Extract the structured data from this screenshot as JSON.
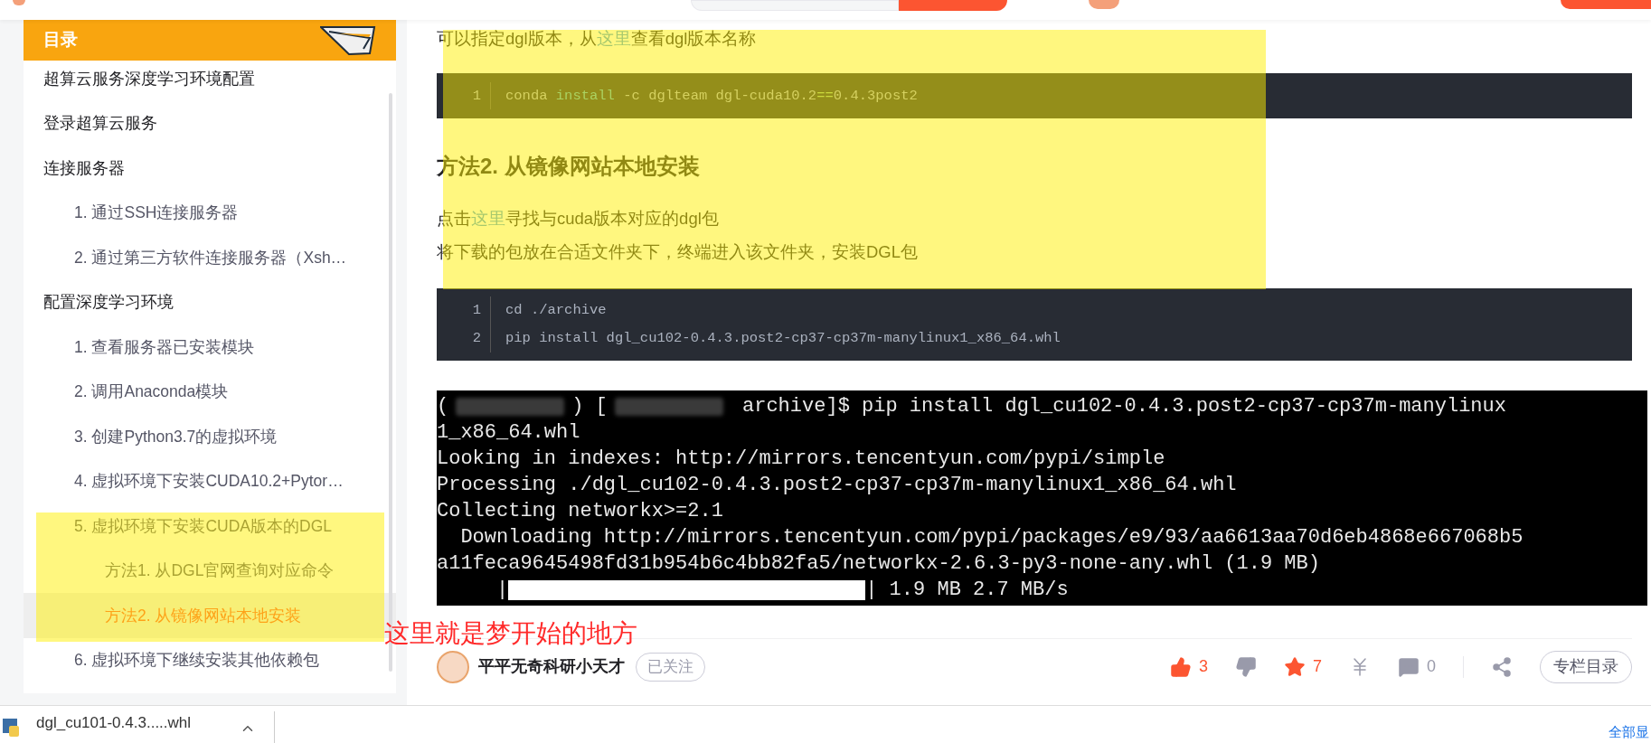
{
  "toc": {
    "title": "目录",
    "items": [
      {
        "label": "超算云服务深度学习环境配置",
        "selected": false
      },
      {
        "label": "登录超算云服务",
        "selected": false
      },
      {
        "label": "连接服务器",
        "selected": false,
        "children": [
          {
            "label": "1. 通过SSH连接服务器",
            "selected": false
          },
          {
            "label": "2. 通过第三方软件连接服务器（Xsh…",
            "selected": false
          }
        ]
      },
      {
        "label": "配置深度学习环境",
        "selected": false,
        "children": [
          {
            "label": "1. 查看服务器已安装模块",
            "selected": false
          },
          {
            "label": "2. 调用Anaconda模块",
            "selected": false
          },
          {
            "label": "3. 创建Python3.7的虚拟环境",
            "selected": false
          },
          {
            "label": "4. 虚拟环境下安装CUDA10.2+Pytor…",
            "selected": false
          },
          {
            "label": "5. 虚拟环境下安装CUDA版本的DGL",
            "selected": false,
            "children": [
              {
                "label": "方法1. 从DGL官网查询对应命令",
                "selected": false
              },
              {
                "label": "方法2. 从镜像网站本地安装",
                "selected": true
              }
            ]
          },
          {
            "label": "6. 虚拟环境下继续安装其他依赖包",
            "selected": false
          }
        ]
      }
    ]
  },
  "article": {
    "blocks": [
      {
        "kind": "paragraph",
        "lines": [
          [
            {
              "kind": "text",
              "text": "可以指定dgl版本，从"
            },
            {
              "kind": "link",
              "text": "这里"
            },
            {
              "kind": "text",
              "text": "查看dgl版本名称"
            }
          ]
        ]
      },
      {
        "kind": "code",
        "lines": [
          {
            "number": "1",
            "tokens": [
              {
                "text": "conda ",
                "kind": "plain"
              },
              {
                "text": "install",
                "kind": "keyword"
              },
              {
                "text": " -c dglteam dgl-cuda10.2",
                "kind": "plain"
              },
              {
                "text": "==",
                "kind": "operator"
              },
              {
                "text": "0.4.3post2",
                "kind": "plain"
              }
            ]
          }
        ]
      },
      {
        "kind": "heading",
        "text": "方法2. 从镜像网站本地安装"
      },
      {
        "kind": "paragraph",
        "lines": [
          [
            {
              "kind": "text",
              "text": "点击"
            },
            {
              "kind": "link",
              "text": "这里"
            },
            {
              "kind": "text",
              "text": "寻找与cuda版本对应的dgl包"
            }
          ],
          [
            {
              "kind": "text",
              "text": "将下载的包放在合适文件夹下，终端进入该文件夹，安装DGL包"
            }
          ]
        ]
      },
      {
        "kind": "code",
        "lines": [
          {
            "number": "1",
            "tokens": [
              {
                "text": "cd ./archive",
                "kind": "plain"
              }
            ]
          },
          {
            "number": "2",
            "tokens": [
              {
                "text": "pip install dgl_cu102-0.4.3.post2-cp37-cp37m-manylinux1_x86_64.whl",
                "kind": "plain"
              }
            ]
          }
        ]
      },
      {
        "kind": "terminal",
        "lines": [
          [
            {
              "kind": "text",
              "text": "("
            },
            {
              "kind": "blur"
            },
            {
              "kind": "text",
              "text": ") ["
            },
            {
              "kind": "blur"
            },
            {
              "kind": "text",
              "text": " archive]$ pip install dgl_cu102-0.4.3.post2-cp37-cp37m-manylinux"
            }
          ],
          [
            {
              "kind": "text",
              "text": "1_x86_64.whl"
            }
          ],
          [
            {
              "kind": "text",
              "text": "Looking in indexes: http://mirrors.tencentyun.com/pypi/simple"
            }
          ],
          [
            {
              "kind": "text",
              "text": "Processing ./dgl_cu102-0.4.3.post2-cp37-cp37m-manylinux1_x86_64.whl"
            }
          ],
          [
            {
              "kind": "text",
              "text": "Collecting networkx>=2.1"
            }
          ],
          [
            {
              "kind": "text",
              "text": "  Downloading http://mirrors.tencentyun.com/pypi/packages/e9/93/aa6613aa70d6eb4868e667068b5"
            }
          ],
          [
            {
              "kind": "text",
              "text": "a11feca9645498fd31b954b6c4bb82fa5/networkx-2.6.3-py3-none-any.whl (1.9 MB)"
            }
          ],
          [
            {
              "kind": "text",
              "text": "     |"
            },
            {
              "kind": "progress",
              "level": 1
            },
            {
              "kind": "text",
              "text": "| 1.9 MB 2.7 MB/s"
            }
          ]
        ]
      }
    ]
  },
  "annotation": {
    "text": "这里就是梦开始的地方"
  },
  "author": {
    "name": "平平无奇科研小天才",
    "follow_label": "已关注"
  },
  "actions": [
    {
      "kind": "like",
      "count": "3",
      "selected": true
    },
    {
      "kind": "dislike",
      "selected": false
    },
    {
      "kind": "favorite",
      "count": "7",
      "selected": true
    },
    {
      "kind": "reward",
      "selected": false
    },
    {
      "kind": "comment",
      "count": "0",
      "selected": false
    },
    {
      "kind": "share",
      "selected": false
    }
  ],
  "column_button": "专栏目录",
  "download_bar": {
    "file": "dgl_cu101-0.4.3.....whl",
    "show_all": "全部显"
  }
}
